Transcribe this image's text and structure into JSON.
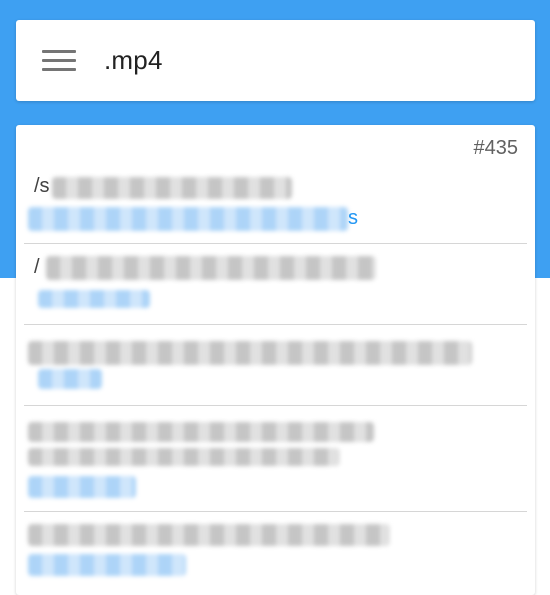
{
  "search": {
    "query": ".mp4"
  },
  "results": {
    "count_badge": "#435",
    "rows": [
      {
        "path_prefix": "/s",
        "link_suffix": "s"
      },
      {
        "path_prefix": "/"
      }
    ]
  },
  "icons": {
    "menu": "menu-icon"
  },
  "colors": {
    "header_blue": "#3ea0f2",
    "link_blue": "#2196f3",
    "text_dark": "#222222",
    "text_gray": "#616161"
  }
}
